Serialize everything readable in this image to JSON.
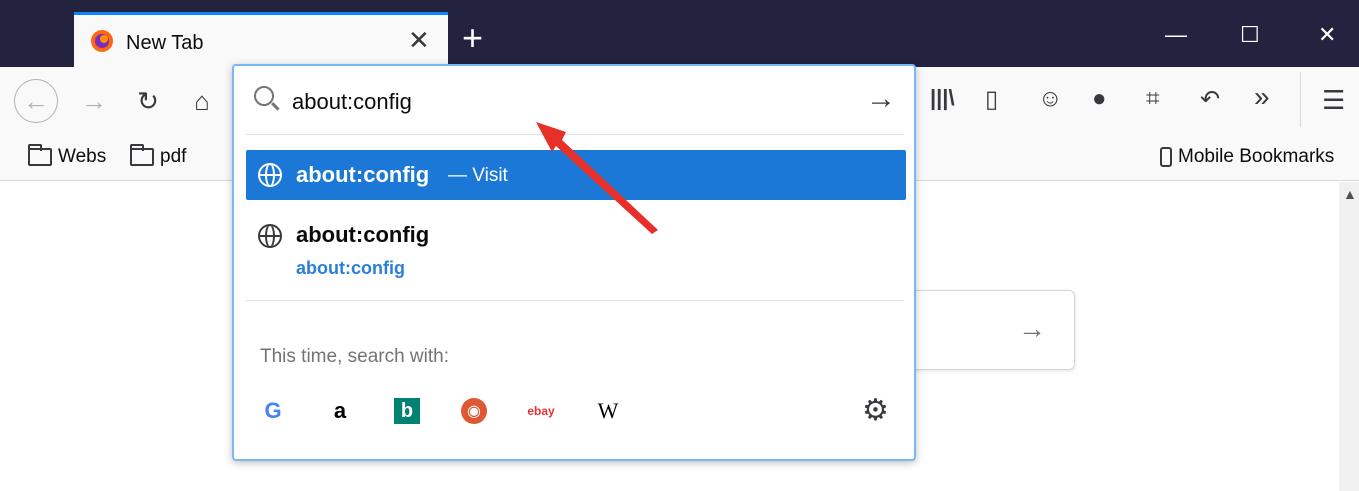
{
  "tab": {
    "title": "New Tab"
  },
  "window_controls": {
    "minimize": "—",
    "maximize": "☐",
    "close": "✕"
  },
  "toolbar": {
    "back": "←",
    "forward": "→",
    "reload": "↻",
    "home": "⌂",
    "library": "|||\\",
    "sidebar": "▯",
    "account": "☺",
    "chat": "●",
    "crop": "⌗",
    "undo": "↶",
    "overflow": "»",
    "menu": "☰"
  },
  "bookmarks": [
    {
      "label": "Webs"
    },
    {
      "label": "pdf"
    }
  ],
  "mobile_bookmarks": "Mobile Bookmarks",
  "urlbar": {
    "value": "about:config"
  },
  "results": {
    "selected": {
      "title": "about:config",
      "action": "— Visit"
    },
    "second": {
      "title": "about:config",
      "url": "about:config"
    }
  },
  "search_with_label": "This time, search with:",
  "engines": [
    {
      "name": "google-icon",
      "glyph": "G"
    },
    {
      "name": "amazon-icon",
      "glyph": "a"
    },
    {
      "name": "bing-icon",
      "glyph": "b"
    },
    {
      "name": "duckduckgo-icon",
      "glyph": "◉"
    },
    {
      "name": "ebay-icon",
      "glyph": "ebay"
    },
    {
      "name": "wikipedia-icon",
      "glyph": "W"
    }
  ],
  "colors": {
    "accent": "#1b78d6",
    "titlebar": "#23233f",
    "arrow": "#e8302a"
  }
}
